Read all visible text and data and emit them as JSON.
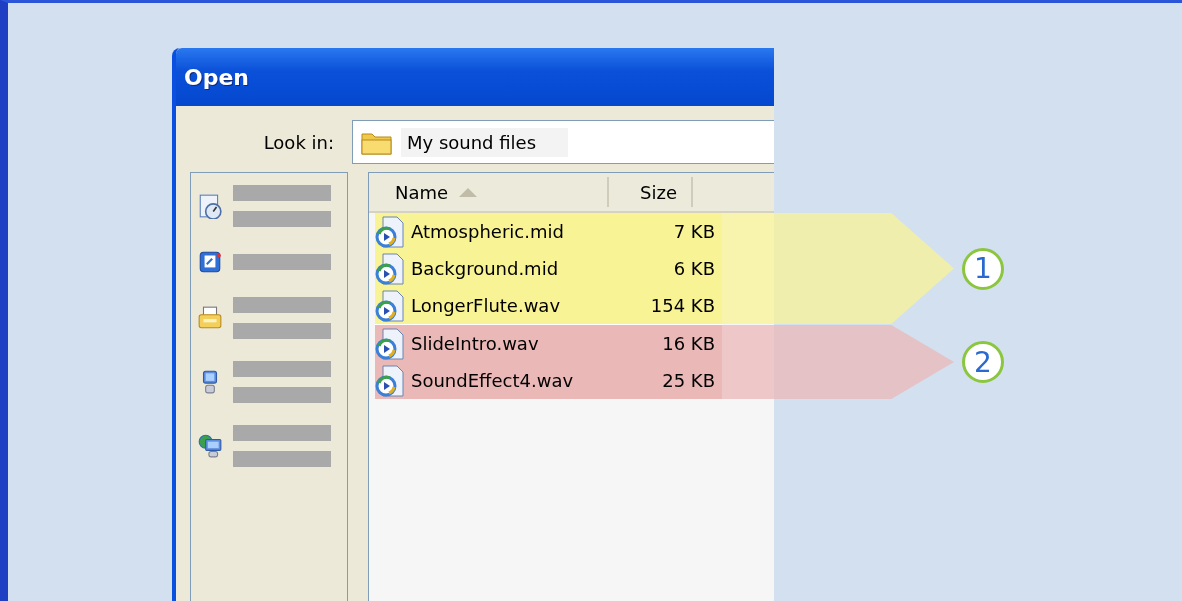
{
  "window": {
    "title": "Open"
  },
  "look_in": {
    "label": "Look in:",
    "value": "My sound files"
  },
  "file_list": {
    "columns": [
      {
        "label": "Name",
        "sorted": true
      },
      {
        "label": "Size",
        "sorted": false
      }
    ],
    "groups": [
      {
        "number": "1",
        "color": "#f8f395",
        "files": [
          {
            "name": "Atmospheric.mid",
            "size": "7 KB"
          },
          {
            "name": "Background.mid",
            "size": "6 KB"
          },
          {
            "name": "LongerFlute.wav",
            "size": "154 KB"
          }
        ]
      },
      {
        "number": "2",
        "color": "#ebb8b8",
        "files": [
          {
            "name": "SlideIntro.wav",
            "size": "16 KB"
          },
          {
            "name": "SoundEffect4.wav",
            "size": "25 KB"
          }
        ]
      }
    ]
  }
}
